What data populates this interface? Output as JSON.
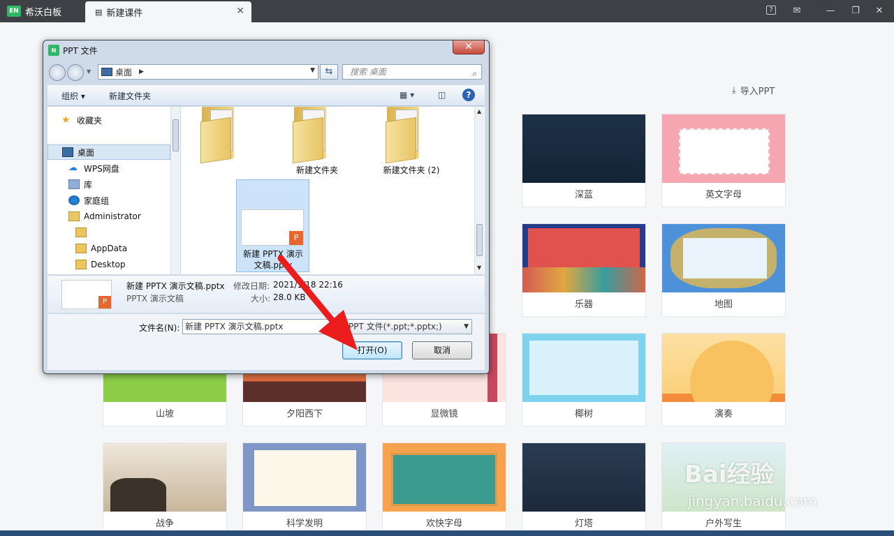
{
  "app": {
    "name": "希沃白板",
    "logo_text": "EN",
    "tab_title": "新建课件",
    "tab_close": "✕"
  },
  "topbar_icons": [
    "help-icon",
    "mail-icon",
    "minimize-icon",
    "restore-icon",
    "close-icon"
  ],
  "import_label": "导入PPT",
  "templates": [
    {
      "label": "深蓝"
    },
    {
      "label": "英文字母"
    },
    {
      "label": "乐器"
    },
    {
      "label": "地图"
    },
    {
      "label": "山坡"
    },
    {
      "label": "夕阳西下"
    },
    {
      "label": "显微镜"
    },
    {
      "label": "椰树"
    },
    {
      "label": "演奏"
    },
    {
      "label": "战争"
    },
    {
      "label": "科学发明"
    },
    {
      "label": "欢快字母"
    },
    {
      "label": "灯塔"
    },
    {
      "label": "户外写生"
    }
  ],
  "dialog": {
    "title": "PPT 文件",
    "icon_text": "N",
    "address": "桌面",
    "search_placeholder": "搜索 桌面",
    "toolbar": {
      "organize": "组织 ▾",
      "new_folder": "新建文件夹"
    },
    "nav_items": [
      {
        "label": "收藏夹",
        "icon": "star-icon"
      },
      {
        "label": "桌面",
        "icon": "desktop-icon"
      },
      {
        "label": "WPS网盘",
        "icon": "cloud-icon"
      },
      {
        "label": "库",
        "icon": "library-icon"
      },
      {
        "label": "家庭组",
        "icon": "homegroup-icon"
      },
      {
        "label": "Administrator",
        "icon": "user-folder-icon"
      },
      {
        "label": "",
        "icon": "folder-icon"
      },
      {
        "label": "AppData",
        "icon": "folder-icon"
      },
      {
        "label": "Desktop",
        "icon": "folder-icon"
      }
    ],
    "files": [
      {
        "label": ""
      },
      {
        "label": "新建文件夹"
      },
      {
        "label": "新建文件夹 (2)"
      },
      {
        "label": "新建 PPTX 演示文稿.pptx"
      }
    ],
    "details": {
      "name": "新建 PPTX 演示文稿.pptx",
      "type": "PPTX 演示文稿",
      "modified_label": "修改日期:",
      "modified_value": "2021/1/18 22:16",
      "size_label": "大小:",
      "size_value": "28.0 KB"
    },
    "filename_label": "文件名(N):",
    "filename_value": "新建 PPTX 演示文稿.pptx",
    "filter_value": "PPT 文件(*.ppt;*.pptx;)",
    "open_button": "打开(O)",
    "cancel_button": "取消"
  },
  "watermark": {
    "brand": "Bai经验",
    "url": "jingyan.baidu.com"
  }
}
